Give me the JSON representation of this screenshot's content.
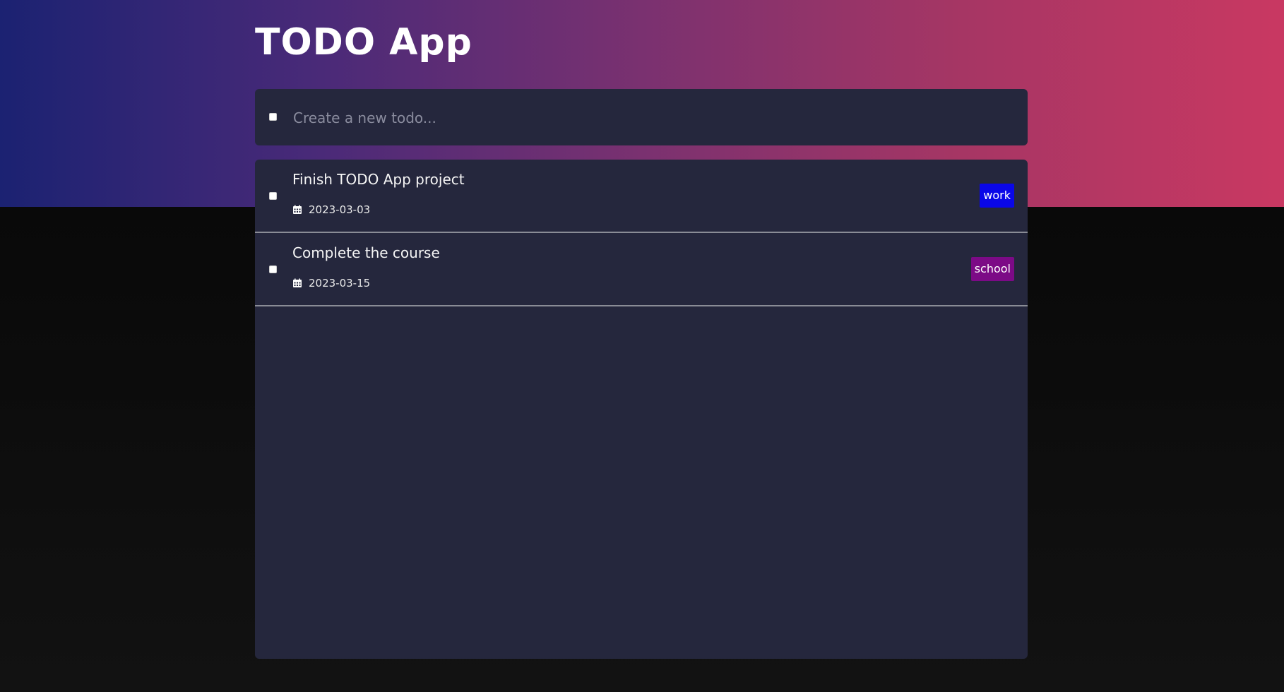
{
  "app": {
    "title": "TODO App"
  },
  "new_todo": {
    "placeholder": "Create a new todo..."
  },
  "todos": [
    {
      "title": "Finish TODO App project",
      "date": "2023-03-03",
      "tag": "work",
      "tag_color": "#0a07e8",
      "completed": false
    },
    {
      "title": "Complete the course",
      "date": "2023-03-15",
      "tag": "school",
      "tag_color": "#7c0a86",
      "completed": false
    }
  ],
  "icons": {
    "date": "calendar-icon"
  },
  "colors": {
    "gradient_start": "#1b2272",
    "gradient_end": "#c93862",
    "panel": "#25273d"
  }
}
